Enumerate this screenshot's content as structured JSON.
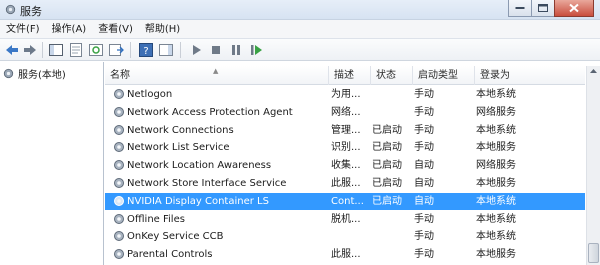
{
  "window": {
    "title": "服务"
  },
  "menubar": {
    "items": [
      "文件(F)",
      "操作(A)",
      "查看(V)",
      "帮助(H)"
    ]
  },
  "toolbar": {
    "icons": [
      "back-icon",
      "forward-icon",
      "console-tree-icon",
      "properties-icon",
      "refresh-icon",
      "export-list-icon",
      "help-icon",
      "show-hide-action-pane-icon",
      "start-service-icon",
      "stop-service-icon",
      "pause-service-icon",
      "restart-service-icon"
    ]
  },
  "tree": {
    "root_label": "服务(本地)"
  },
  "table": {
    "columns": [
      "名称",
      "描述",
      "状态",
      "启动类型",
      "登录为"
    ],
    "rows": [
      {
        "name": "Netlogon",
        "desc": "为用...",
        "status": "",
        "startup": "手动",
        "logon": "本地系统",
        "selected": false
      },
      {
        "name": "Network Access Protection Agent",
        "desc": "网络...",
        "status": "",
        "startup": "手动",
        "logon": "网络服务",
        "selected": false
      },
      {
        "name": "Network Connections",
        "desc": "管理...",
        "status": "已启动",
        "startup": "手动",
        "logon": "本地系统",
        "selected": false
      },
      {
        "name": "Network List Service",
        "desc": "识别...",
        "status": "已启动",
        "startup": "手动",
        "logon": "本地服务",
        "selected": false
      },
      {
        "name": "Network Location Awareness",
        "desc": "收集...",
        "status": "已启动",
        "startup": "自动",
        "logon": "网络服务",
        "selected": false
      },
      {
        "name": "Network Store Interface Service",
        "desc": "此服...",
        "status": "已启动",
        "startup": "自动",
        "logon": "本地服务",
        "selected": false
      },
      {
        "name": "NVIDIA Display Container LS",
        "desc": "Cont...",
        "status": "已启动",
        "startup": "自动",
        "logon": "本地系统",
        "selected": true
      },
      {
        "name": "Offline Files",
        "desc": "脱机...",
        "status": "",
        "startup": "手动",
        "logon": "本地系统",
        "selected": false
      },
      {
        "name": "OnKey Service CCB",
        "desc": "",
        "status": "",
        "startup": "手动",
        "logon": "本地系统",
        "selected": false
      },
      {
        "name": "Parental Controls",
        "desc": "此服...",
        "status": "",
        "startup": "手动",
        "logon": "本地服务",
        "selected": false
      }
    ]
  },
  "colors": {
    "selection": "#3399ff",
    "titlebar": "#dbe6f4"
  }
}
